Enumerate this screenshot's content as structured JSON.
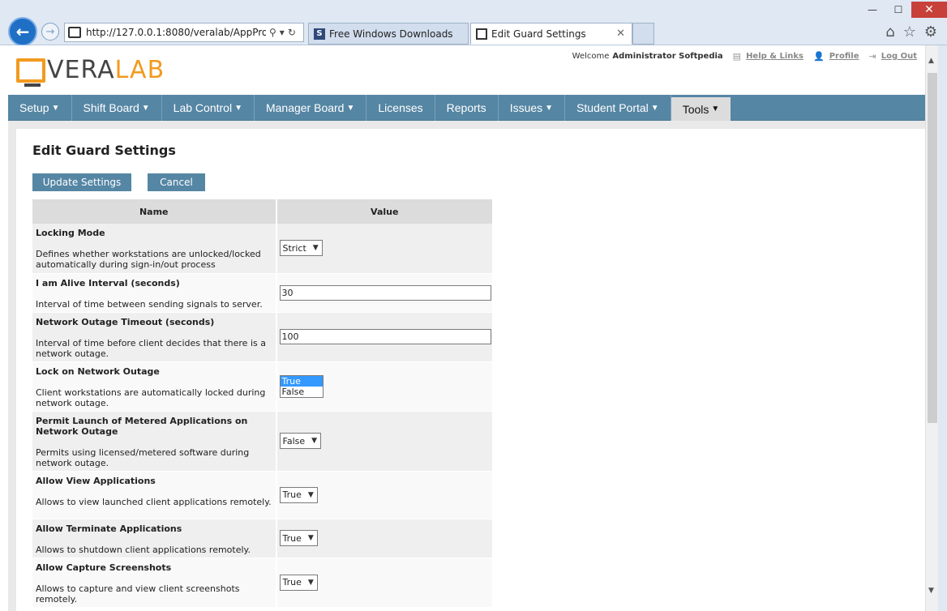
{
  "browser": {
    "url": "http://127.0.0.1:8080/veralab/AppPropert",
    "tabs": [
      {
        "label": "Free Windows Downloads",
        "favicon": "S"
      },
      {
        "label": "Edit Guard Settings"
      }
    ],
    "window_controls": {
      "minimize": "—",
      "maximize": "☐",
      "close": "✕"
    }
  },
  "header": {
    "logo_part1": "VERA",
    "logo_part2": "LAB",
    "welcome_prefix": "Welcome",
    "user": "Administrator Softpedia",
    "links": [
      "Help & Links",
      "Profile",
      "Log Out"
    ]
  },
  "menu": [
    {
      "label": "Setup",
      "dropdown": true
    },
    {
      "label": "Shift Board",
      "dropdown": true
    },
    {
      "label": "Lab Control",
      "dropdown": true
    },
    {
      "label": "Manager Board",
      "dropdown": true
    },
    {
      "label": "Licenses",
      "dropdown": false
    },
    {
      "label": "Reports",
      "dropdown": false
    },
    {
      "label": "Issues",
      "dropdown": true
    },
    {
      "label": "Student Portal",
      "dropdown": true
    },
    {
      "label": "Tools",
      "dropdown": true,
      "active": true
    }
  ],
  "page": {
    "title": "Edit Guard Settings",
    "update_button": "Update Settings",
    "cancel_button": "Cancel",
    "columns": [
      "Name",
      "Value"
    ]
  },
  "settings": [
    {
      "name": "Locking Mode",
      "desc": "Defines whether workstations are unlocked/locked automatically during sign-in/out process",
      "type": "select",
      "value": "Strict"
    },
    {
      "name": "I am Alive Interval (seconds)",
      "desc": "Interval of time between sending signals to server.",
      "type": "text",
      "value": "30"
    },
    {
      "name": "Network Outage Timeout (seconds)",
      "desc": "Interval of time before client decides that there is a network outage.",
      "type": "text",
      "value": "100"
    },
    {
      "name": "Lock on Network Outage",
      "desc": "Client workstations are automatically locked during network outage.",
      "type": "listbox",
      "options": [
        "True",
        "False"
      ],
      "value": "True"
    },
    {
      "name": "Permit Launch of Metered Applications on Network Outage",
      "desc": "Permits using licensed/metered software during network outage.",
      "type": "select",
      "value": "False"
    },
    {
      "name": "Allow View Applications",
      "desc": "Allows to view launched client applications remotely.",
      "type": "select",
      "value": "True"
    },
    {
      "name": "Allow Terminate Applications",
      "desc": "Allows to shutdown client applications remotely.",
      "type": "select",
      "value": "True"
    },
    {
      "name": "Allow Capture Screenshots",
      "desc": "Allows to capture and view client screenshots remotely.",
      "type": "select",
      "value": "True"
    }
  ],
  "colors": {
    "menubar": "#5586a4",
    "accent": "#f29a1f",
    "button": "#5586a4"
  }
}
